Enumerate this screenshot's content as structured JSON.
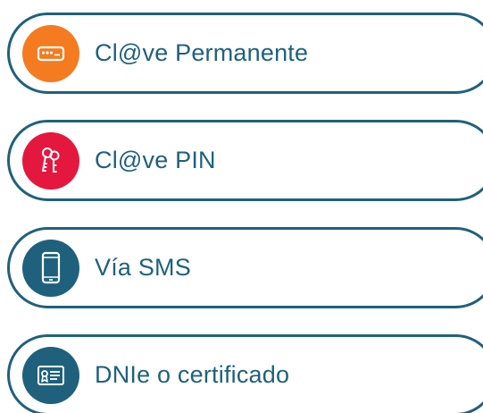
{
  "login_options": [
    {
      "label": "Cl@ve Permanente",
      "icon": "password-dots-icon",
      "color": "#f47b20"
    },
    {
      "label": "Cl@ve PIN",
      "icon": "keys-icon",
      "color": "#e4173e"
    },
    {
      "label": "Vía SMS",
      "icon": "mobile-phone-icon",
      "color": "#1f617c"
    },
    {
      "label": "DNIe o certificado",
      "icon": "certificate-icon",
      "color": "#1f617c"
    }
  ],
  "colors": {
    "border": "#1f617c",
    "text": "#1f617c",
    "background": "#ffffff"
  }
}
